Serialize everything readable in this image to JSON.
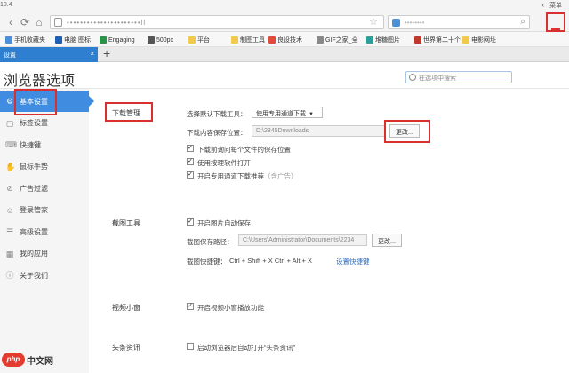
{
  "browser": {
    "version": "10.4",
    "url_placeholder": "••••••••••••••••••••••ll",
    "search_placeholder": "••••••••",
    "menu_label": "菜单"
  },
  "bookmarks": [
    {
      "label": "手机收藏夹",
      "color": "#4a90d9"
    },
    {
      "label": "电脑 图标",
      "color": "#1d5fb0"
    },
    {
      "label": "Engaging",
      "color": "#2b9348"
    },
    {
      "label": "500px",
      "color": "#555555"
    },
    {
      "label": "平台",
      "color": "#f2c94c"
    },
    {
      "label": "制图工具",
      "color": "#f2c94c"
    },
    {
      "label": "良设技术",
      "color": "#e24a3b"
    },
    {
      "label": "GIF之家_全",
      "color": "#888888"
    },
    {
      "label": "堆糖图片",
      "color": "#2aa198"
    },
    {
      "label": "世界第二十个",
      "color": "#c0392b"
    },
    {
      "label": "电影网址",
      "color": "#f2c94c"
    }
  ],
  "tab": {
    "label": "设置",
    "close": "×",
    "new_tab": "+"
  },
  "page": {
    "title": "浏览器选项",
    "search_placeholder": "在选项中搜索"
  },
  "sidebar": {
    "items": [
      {
        "label": "基本设置",
        "icon": "gear-icon",
        "glyph": "⚙",
        "active": true
      },
      {
        "label": "标签设置",
        "icon": "tab-icon",
        "glyph": "▢"
      },
      {
        "label": "快捷键",
        "icon": "keyboard-icon",
        "glyph": "⌨"
      },
      {
        "label": "鼠标手势",
        "icon": "mouse-icon",
        "glyph": "✋"
      },
      {
        "label": "广告过滤",
        "icon": "filter-icon",
        "glyph": "⊘"
      },
      {
        "label": "登录管家",
        "icon": "login-icon",
        "glyph": "☺"
      },
      {
        "label": "高级设置",
        "icon": "advanced-icon",
        "glyph": "☰"
      },
      {
        "label": "我的应用",
        "icon": "apps-icon",
        "glyph": "▦"
      },
      {
        "label": "关于我们",
        "icon": "about-icon",
        "glyph": "ⓘ"
      }
    ]
  },
  "download": {
    "section": "下载管理",
    "tool_label": "选择默认下载工具：",
    "tool_value": "使用专用通道下载",
    "location_label": "下载内容保存位置：",
    "location_value": "D:\\2345Downloads",
    "change_button": "更改...",
    "options": [
      {
        "label": "下载前询问每个文件的保存位置",
        "checked": true
      },
      {
        "label": "使用按理软件打开",
        "checked": true
      },
      {
        "label": "开启专用通道下载推荐",
        "hint": "（含广告）",
        "checked": true
      }
    ]
  },
  "screenshot": {
    "section": "截图工具",
    "auto_save": "开启图片自动保存",
    "path_label": "截图保存路径：",
    "path_value": "C:\\Users\\Administrator\\Documents\\2234",
    "change_button": "更改...",
    "shortcut_label": "截图快捷键：",
    "shortcut_value": "Ctrl + Shift + X  Ctrl + Alt + X",
    "shortcut_link": "设置快捷键"
  },
  "video": {
    "section": "视频小窗",
    "option": "开启视频小窗播放功能"
  },
  "news": {
    "section": "头条资讯",
    "option": "启动浏览器后自动打开“头条资讯”"
  },
  "watermark": {
    "logo": "php",
    "text": "中文网"
  }
}
